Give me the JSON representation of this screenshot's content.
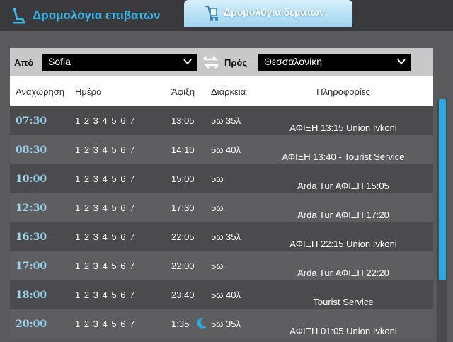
{
  "tabs": [
    {
      "label": "Δρομολόγια επιβατών",
      "icon": "passenger-seat-icon",
      "active": true
    },
    {
      "label": "Δρομολόγια δεμάτων",
      "icon": "parcel-trolley-icon",
      "active": false
    }
  ],
  "filter": {
    "from_label": "Από",
    "from_value": "Sofia",
    "swap_icon": "swap-arrows-icon",
    "to_label": "Πρός",
    "to_value": "Θεσσαλονίκη"
  },
  "table": {
    "headers": {
      "departure": "Αναχώρηση",
      "days": "Ημέρα",
      "arrival": "Άφιξη",
      "duration": "Διάρκεια",
      "info": "Πληροφορίες"
    },
    "rows": [
      {
        "departure": "07:30",
        "days": "1 2 3 4 5 6 7",
        "arrival": "13:05",
        "duration": "5ω 35λ",
        "info": "ΑΦΙΞΗ 13:15 Union Ivkoni"
      },
      {
        "departure": "08:30",
        "days": "1 2 3 4 5 6 7",
        "arrival": "14:10",
        "duration": "5ω 40λ",
        "info": "ΑΦΙΞΗ 13:40 - Tourist Service"
      },
      {
        "departure": "10:00",
        "days": "1 2 3 4 5 6 7",
        "arrival": "15:00",
        "duration": "5ω",
        "info": "Arda Tur ΑΦΙΞΗ 15:05"
      },
      {
        "departure": "12:30",
        "days": "1 2 3 4 5 6 7",
        "arrival": "17:30",
        "duration": "5ω",
        "info": "Arda Tur ΑΦΙΞΗ 17:20"
      },
      {
        "departure": "16:30",
        "days": "1 2 3 4 5 6 7",
        "arrival": "22:05",
        "duration": "5ω 35λ",
        "info": "ΑΦΙΞΗ 22:15 Union Ivkoni"
      },
      {
        "departure": "17:00",
        "days": "1 2 3 4 5 6 7",
        "arrival": "22:00",
        "duration": "5ω",
        "info": "Arda Tur ΑΦΙΞΗ 22:20"
      },
      {
        "departure": "18:00",
        "days": "1 2 3 4 5 6 7",
        "arrival": "23:40",
        "duration": "5ω 40λ",
        "info": "Tourist Service"
      },
      {
        "departure": "20:00",
        "days": "1 2 3 4 5 6 7",
        "arrival": "1:35",
        "duration": "5ω 35λ",
        "info": "ΑΦΙΞΗ 01:05 Union Ivkoni",
        "next_day_icon": "moon-icon"
      }
    ]
  },
  "colors": {
    "accent": "#2aa8e0",
    "departure_time": "#9ad3ee",
    "background": "#5a5a5c"
  }
}
